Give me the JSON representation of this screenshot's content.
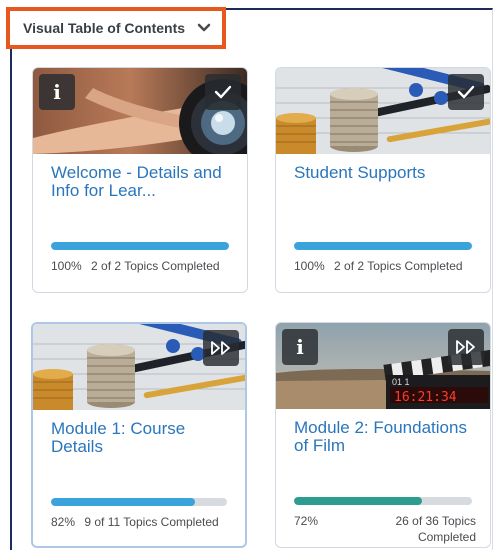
{
  "vtoc": {
    "title": "Visual Table of Contents"
  },
  "colors": {
    "accent_orange": "#e8571e",
    "title_blue": "#2a76bc",
    "progress_blue": "#3ba3dc",
    "progress_teal": "#2d9d8f",
    "track_grey": "#d7dbe0"
  },
  "cards": [
    {
      "title": "Welcome - Details and Info for Lear...",
      "percent": "100%",
      "topics": "2 of 2 Topics Completed",
      "progress": 1.0,
      "badge_left": "info-icon",
      "badge_right": "checkmark-icon"
    },
    {
      "title": "Student Supports",
      "percent": "100%",
      "topics": "2 of 2 Topics Completed",
      "progress": 1.0,
      "badge_right": "checkmark-icon"
    },
    {
      "title": "Module 1: Course Details",
      "percent": "82%",
      "topics": "9 of 11 Topics Completed",
      "progress": 0.82,
      "badge_right": "skip-forward-icon"
    },
    {
      "title": "Module 2: Foundations of Film",
      "percent": "72%",
      "topics": "26 of 36 Topics Completed",
      "progress": 0.72,
      "badge_left": "info-icon",
      "badge_right": "skip-forward-icon"
    }
  ]
}
